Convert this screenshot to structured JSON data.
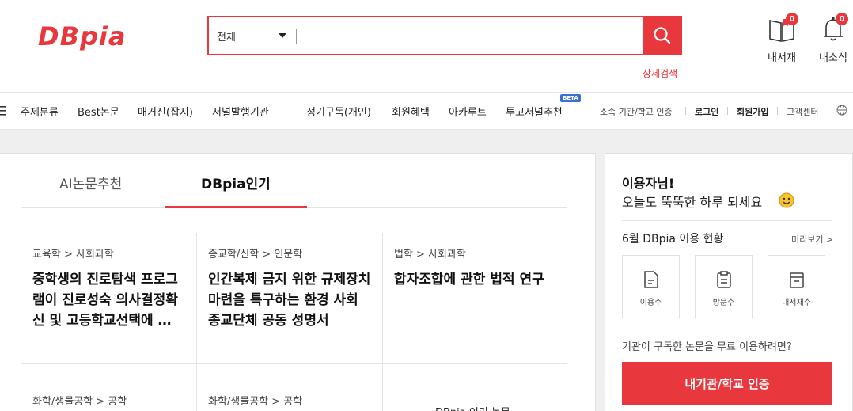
{
  "brand": {
    "logo_text": "DBpia",
    "accent_color": "#e8383d"
  },
  "search": {
    "scope_selected": "전체",
    "placeholder": "",
    "value": "",
    "advanced_label": "상세검색"
  },
  "header_icons": {
    "library": {
      "label": "내서재",
      "count": "0",
      "icon": "book-icon"
    },
    "news": {
      "label": "내소식",
      "count": "0",
      "icon": "bell-icon"
    }
  },
  "nav": {
    "menu_icon": "menu-icon",
    "items": [
      "주제분류",
      "Best논문",
      "매거진(잡지)",
      "저널발행기관",
      "정기구독(개인)",
      "회원혜택",
      "아카루트",
      "투고저널추천"
    ],
    "beta_badge": "BETA",
    "utility": [
      "소속 기관/학교 인증",
      "로그인",
      "회원가입",
      "고객센터"
    ],
    "globe_icon": "globe-icon"
  },
  "tabs": [
    {
      "label": "AI논문추천",
      "active": false
    },
    {
      "label": "DBpia인기",
      "active": true
    }
  ],
  "papers": [
    {
      "category": "교육학 > 사회과학",
      "title": "중학생의 진로탐색 프로그램이 진로성숙 의사결정확신 및 고등학교선택에 미치는 영향"
    },
    {
      "category": "종교학/신학 > 인문학",
      "title": "인간복제 금지 위한 규제장치 마련을 특구하는 환경 사회 종교단체 공동 성명서"
    },
    {
      "category": "법학 > 사회과학",
      "title": "합자조합에 관한 법적 연구"
    },
    {
      "category": "화학/생물공학 > 공학",
      "title": ""
    },
    {
      "category": "화학/생물공학 > 공학",
      "title": ""
    },
    {
      "category": "",
      "title": "DBpia 인기 논문"
    }
  ],
  "sidebar": {
    "greeting_name": "이용자님!",
    "greeting_msg": "오늘도 뚝뚝한 하루 되세요",
    "usage_title": "6월 DBpia 이용 현황",
    "preview_label": "미리보기 >",
    "stats": [
      {
        "label": "이용수",
        "icon": "document-icon"
      },
      {
        "label": "방문수",
        "icon": "clipboard-icon"
      },
      {
        "label": "내서재수",
        "icon": "archive-icon"
      }
    ],
    "institution_question": "기관이 구독한 논문을 무료 이용하려면?",
    "institution_button": "내기관/학교 인증"
  }
}
